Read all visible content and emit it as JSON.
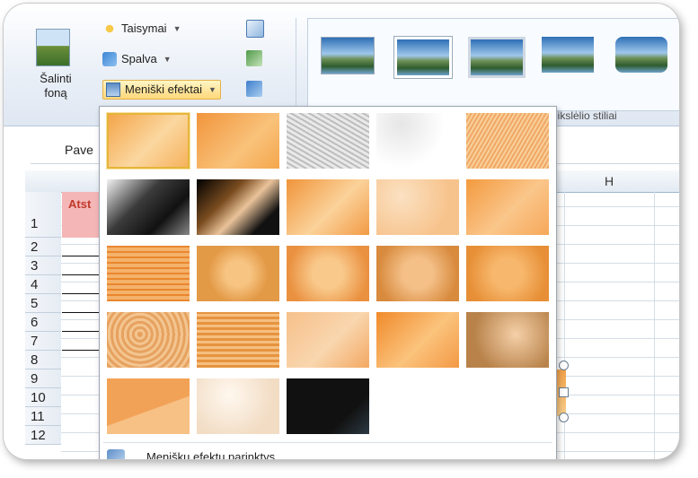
{
  "ribbon": {
    "remove_bg_label_1": "Šalinti",
    "remove_bg_label_2": "foną",
    "corrections_label": "Taisymai",
    "color_label": "Spalva",
    "artistic_label": "Meniški efektai",
    "styles_group_label": "eikslėlio stiliai"
  },
  "sheet": {
    "name_box": "Pave",
    "column_h": "H",
    "row_numbers": [
      "1",
      "2",
      "3",
      "4",
      "5",
      "6",
      "7",
      "8",
      "9",
      "10",
      "11",
      "12"
    ],
    "cell_text": "Atst"
  },
  "dropdown": {
    "options_label": "Meniškų efektų parinktys...",
    "tiles": [
      "none",
      "marker",
      "pencil-grayscale",
      "pencil-sketch",
      "line-drawing",
      "chalk-sketch",
      "paint-strokes",
      "paint-brush",
      "glow-diffused",
      "blur",
      "light-screen",
      "watercolor-sponge",
      "film-grain",
      "mosaic-bubbles",
      "glass",
      "cement",
      "texturizer",
      "crisscross-etching",
      "pastels-smooth",
      "plastic-wrap",
      "cutout",
      "photocopy",
      "glow-edges"
    ]
  },
  "colors": {
    "selected_border": "#e6b53a",
    "header_red": "#f4b6b6"
  }
}
